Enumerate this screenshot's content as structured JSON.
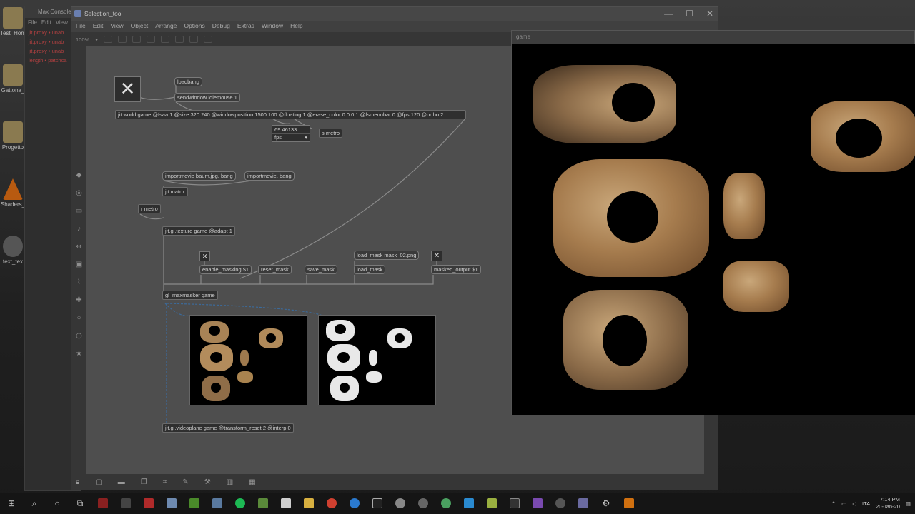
{
  "desktop": {
    "icons": [
      {
        "label": "Test_Hom",
        "kind": "folder"
      },
      {
        "label": "Gattona_",
        "kind": "folder"
      },
      {
        "label": "Progetto",
        "kind": "folder"
      },
      {
        "label": "Shaders_",
        "kind": "vlc"
      },
      {
        "label": "text_tex",
        "kind": "app"
      }
    ]
  },
  "console": {
    "title": "Max Console",
    "menu": [
      "File",
      "Edit",
      "View"
    ],
    "lines": [
      "jit.proxy • unab",
      "jit.proxy • unab",
      "jit.proxy • unab",
      "length • patchca"
    ]
  },
  "window": {
    "title": "Selection_tool",
    "menu": [
      "File",
      "Edit",
      "View",
      "Object",
      "Arrange",
      "Options",
      "Debug",
      "Extras",
      "Window",
      "Help"
    ],
    "zoom": "100%",
    "controls": {
      "minimize": "—",
      "maximize": "☐",
      "close": "✕"
    }
  },
  "patch": {
    "loadbang": "loadbang",
    "sendwindow": "sendwindow idlemouse 1",
    "jitworld": "jit.world game @fsaa 1 @size 320 240 @windowposition 1500 100 @floating 1 @erase_color 0 0 0 1 @fsmenubar 0 @fps 120 @ortho 2",
    "fps_value": "69.46133",
    "fps_label": "fps",
    "s_metro": "s metro",
    "importmovie1": "importmovie baum.jpg, bang",
    "importmovie2": "importmovie, bang",
    "jitmatrix": "jit.matrix",
    "r_metro": "r metro",
    "jitgltexture": "jit.gl.texture game @adapt 1",
    "load_mask_file": "load_mask mask_02.png",
    "enable_masking": "enable_masking $1",
    "reset_mask": "reset_mask",
    "save_mask": "save_mask",
    "load_mask": "load_mask",
    "masked_output": "masked_output $1",
    "maxmasker": "gl_maxmasker game",
    "videoplane": "jit.gl.videoplane game @transform_reset 2 @interp 0"
  },
  "game": {
    "title": "game"
  },
  "taskbar": {
    "language": "ITA",
    "time": "7:14 PM",
    "date": "20-Jan-20"
  }
}
